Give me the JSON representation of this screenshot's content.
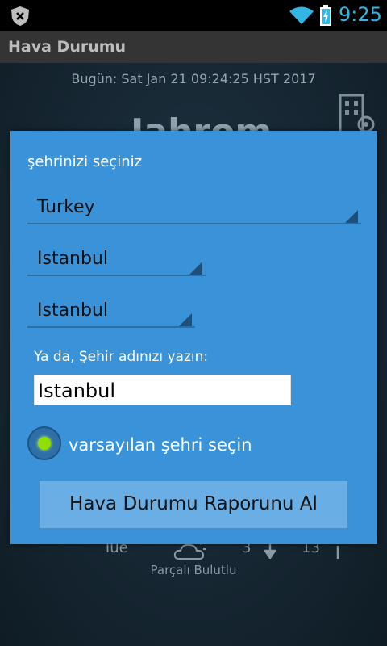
{
  "status_bar": {
    "time": "9:25"
  },
  "app": {
    "title": "Hava Durumu"
  },
  "background": {
    "today": "Bugün: Sat Jan 21 09:24:25 HST 2017",
    "city_partial": "Jahrom",
    "forecast": {
      "day": "Tue",
      "low": "3",
      "high": "13",
      "description": "Parçalı Bulutlu"
    }
  },
  "dialog": {
    "prompt": "şehrinizi seçiniz",
    "country": "Turkey",
    "province": "Istanbul",
    "district": "Istanbul",
    "or_type_label": "Ya da, Şehir adınızı yazın:",
    "city_input_value": "Istanbul",
    "default_city_label": "varsayılan şehri seçin",
    "default_city_checked": true,
    "report_button": "Hava Durumu Raporunu Al"
  },
  "colors": {
    "dialog_bg": "#3a92d9",
    "accent": "#33b5e5",
    "radio_dot": "#8fe000"
  }
}
